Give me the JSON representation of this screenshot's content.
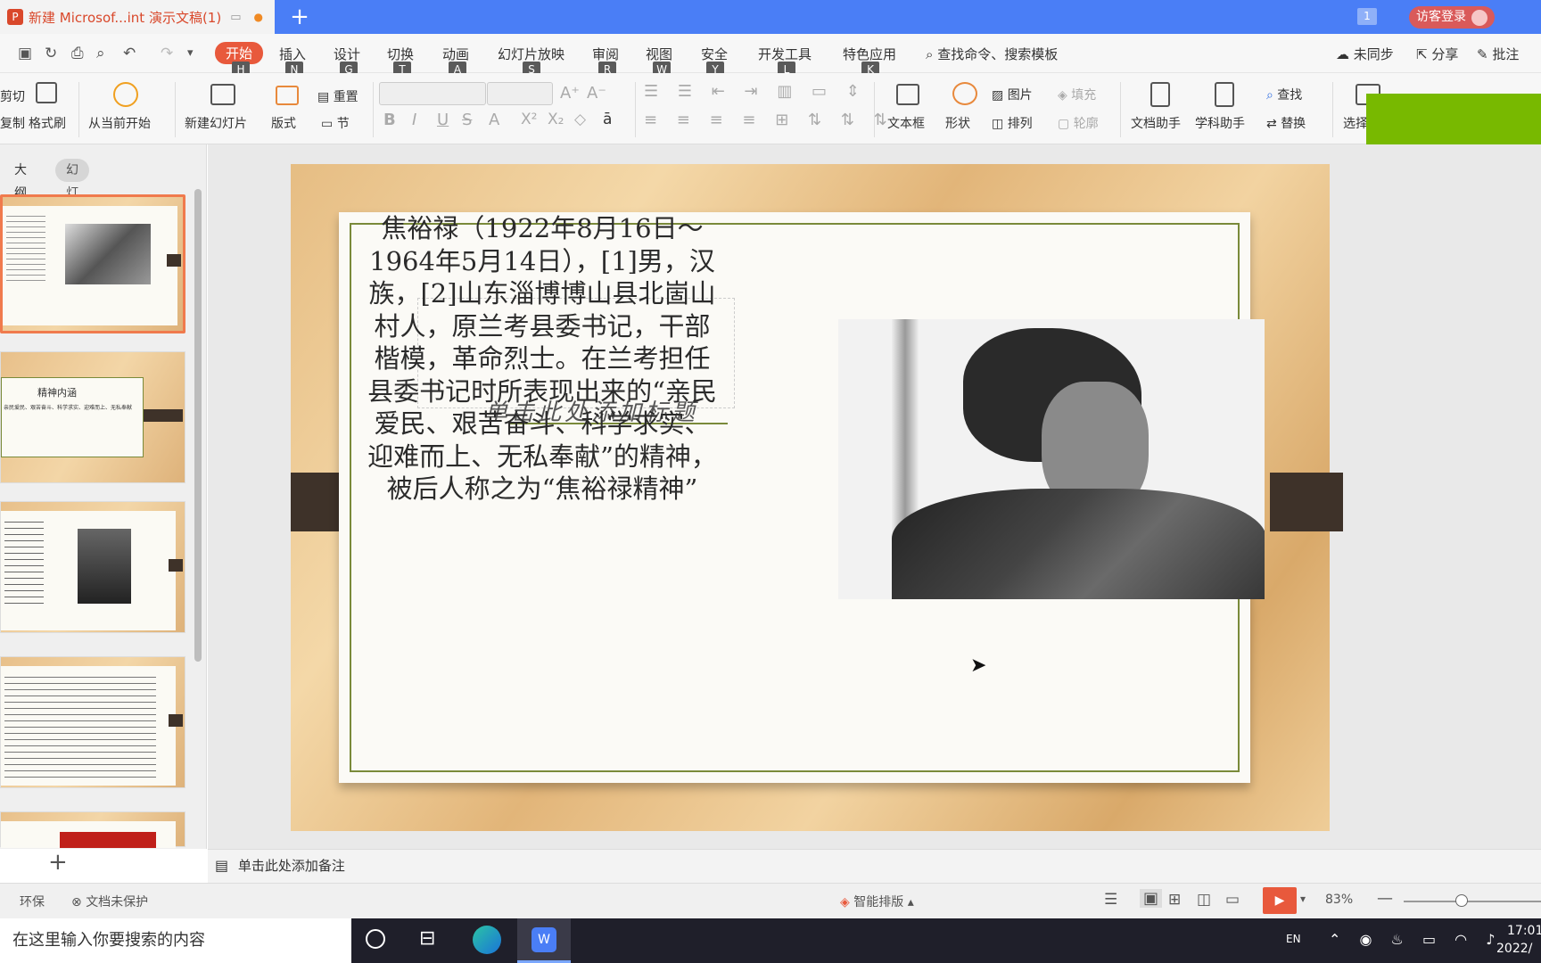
{
  "titlebar": {
    "doc_title": "新建 Microsof...int 演示文稿(1)",
    "badge": "1",
    "guest_login": "访客登录"
  },
  "menu": {
    "items": [
      {
        "label": "开始",
        "key": "H"
      },
      {
        "label": "插入",
        "key": "N"
      },
      {
        "label": "设计",
        "key": "G"
      },
      {
        "label": "切换",
        "key": "T"
      },
      {
        "label": "动画",
        "key": "A"
      },
      {
        "label": "幻灯片放映",
        "key": "S"
      },
      {
        "label": "审阅",
        "key": "R"
      },
      {
        "label": "视图",
        "key": "W"
      },
      {
        "label": "安全",
        "key": "Y"
      },
      {
        "label": "开发工具",
        "key": "L"
      },
      {
        "label": "特色应用",
        "key": "K"
      }
    ],
    "search": "查找命令、搜索模板",
    "unsynced": "未同步",
    "share": "分享",
    "comment": "批注"
  },
  "ribbon": {
    "cut": "剪切",
    "copy": "复制",
    "format_painter": "格式刷",
    "from_current": "从当前开始",
    "new_slide": "新建幻灯片",
    "layout": "版式",
    "reset": "重置",
    "section": "节",
    "textbox": "文本框",
    "shape": "形状",
    "picture": "图片",
    "fill": "填充",
    "arrange": "排列",
    "outline": "轮廓",
    "doc_helper": "文档助手",
    "subject_helper": "学科助手",
    "find": "查找",
    "replace": "替换",
    "select": "选择"
  },
  "sidebar": {
    "tab_outline": "大纲",
    "tab_slides": "幻灯片",
    "thumb2_title": "精神内涵",
    "thumb2_line": "亲民爱民、艰苦奋斗、科学求实、迎难而上、无私奉献"
  },
  "slide": {
    "body_text": "焦裕禄（1922年8月16日～1964年5月14日），[1]男，汉族，[2]山东淄博博山县北崮山村人，原兰考县委书记，干部楷模，革命烈士。在兰考担任县委书记时所表现出来的“亲民爱民、艰苦奋斗、科学求实、迎难而上、无私奉献”的精神，被后人称之为“焦裕禄精神”",
    "placeholder_title": "单击此处添加标题"
  },
  "notes_placeholder": "单击此处添加备注",
  "status": {
    "eco": "环保",
    "unprotected": "文档未保护",
    "smart_layout": "智能排版",
    "zoom": "83%"
  },
  "taskbar": {
    "search_placeholder": "在这里输入你要搜索的内容",
    "lang": "EN",
    "time": "17:01",
    "date": "2022/"
  },
  "colors": {
    "accent": "#e8593c",
    "titlebar": "#4a7ef6",
    "green_block": "#78b900",
    "slide_border": "#7a8a3a"
  }
}
